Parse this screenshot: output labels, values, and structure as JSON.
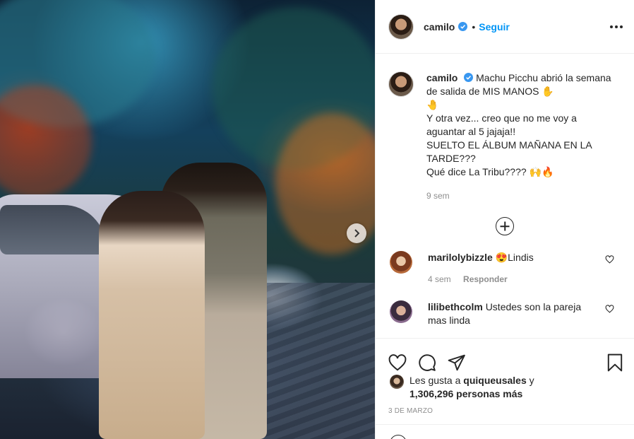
{
  "post": {
    "username": "camilo",
    "follow_label": "Seguir",
    "dot": "•"
  },
  "caption": {
    "username": "camilo",
    "lines": [
      "Machu Picchu abrió la semana de salida de MIS MANOS ✋",
      "🤚",
      "Y otra vez... creo que no me voy a aguantar al 5 jajaja!!",
      "SUELTO EL ÁLBUM MAÑANA EN LA TARDE???",
      "Qué dice La Tribu???? 🙌🔥"
    ],
    "time": "9 sem"
  },
  "comments": [
    {
      "username": "marilolybizzle",
      "text": "😍Lindis",
      "time": "4 sem",
      "reply_label": "Responder"
    },
    {
      "username": "lilibethcolm",
      "text": "Ustedes son la pareja mas linda",
      "time": "",
      "reply_label": ""
    }
  ],
  "likes": {
    "prefix": "Les gusta a",
    "user": "quiqueusales",
    "connector": "y",
    "count": "1,306,296 personas más"
  },
  "date": "3 de marzo",
  "colors": {
    "link": "#0095f6",
    "text": "#262626",
    "muted": "#8e8e8e",
    "verified": "#3897f0"
  },
  "icons": [
    "verified-icon",
    "more-options-icon",
    "heart-icon",
    "comment-icon",
    "share-icon",
    "save-icon",
    "add-icon",
    "carousel-next-icon",
    "emoji-icon"
  ]
}
